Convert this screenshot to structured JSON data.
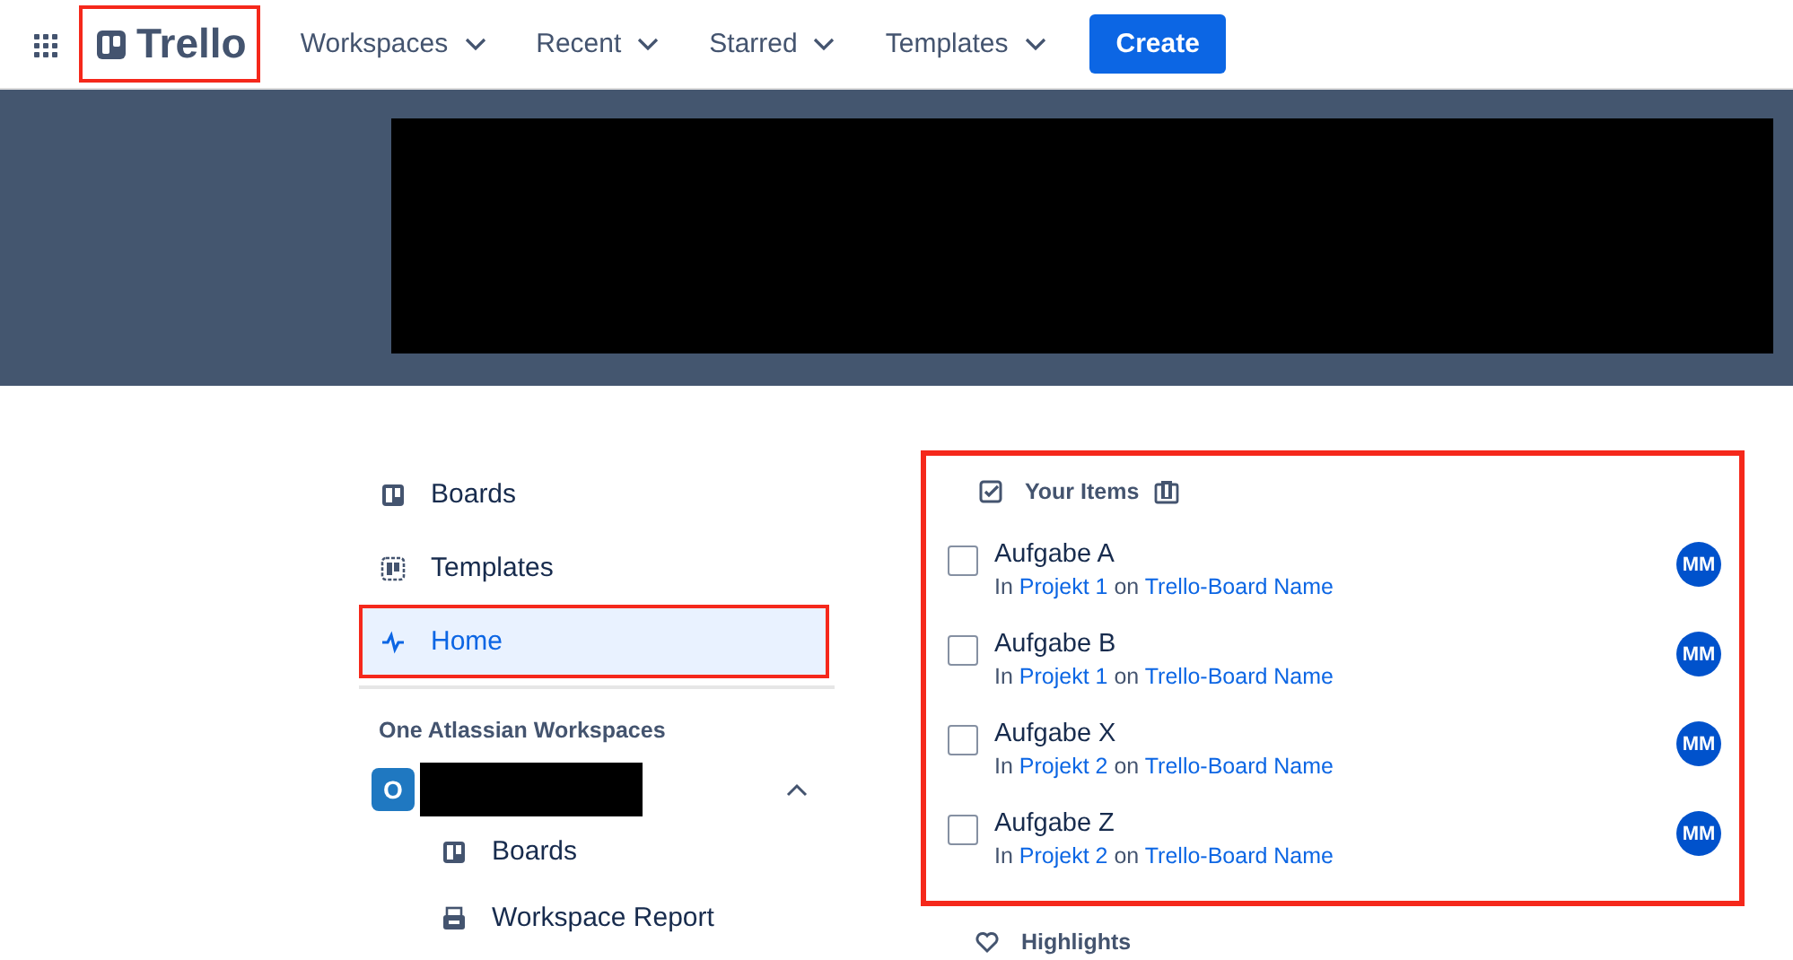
{
  "header": {
    "logo": {
      "text": "Trello",
      "highlighted": true
    },
    "menus": [
      {
        "label": "Workspaces"
      },
      {
        "label": "Recent"
      },
      {
        "label": "Starred"
      },
      {
        "label": "Templates"
      }
    ],
    "create_button": "Create"
  },
  "sidebar": {
    "items": [
      {
        "label": "Boards",
        "kind": "boards",
        "selected": false,
        "highlighted": false
      },
      {
        "label": "Templates",
        "kind": "templates",
        "selected": false,
        "highlighted": false
      },
      {
        "label": "Home",
        "kind": "home",
        "selected": true,
        "highlighted": true
      }
    ],
    "section_title": "One Atlassian Workspaces",
    "workspace": {
      "initial": "O",
      "expanded": true,
      "items": [
        {
          "label": "Boards",
          "kind": "boards"
        },
        {
          "label": "Workspace Report",
          "kind": "report"
        }
      ]
    }
  },
  "your_items": {
    "title": "Your Items",
    "highlighted": true,
    "items": [
      {
        "title": "Aufgabe A",
        "checked": false,
        "prefix": "In",
        "list": "Projekt 1",
        "joiner": "on",
        "board": "Trello-Board Name",
        "avatar": "MM"
      },
      {
        "title": "Aufgabe B",
        "checked": false,
        "prefix": "In",
        "list": "Projekt 1",
        "joiner": "on",
        "board": "Trello-Board Name",
        "avatar": "MM"
      },
      {
        "title": "Aufgabe X",
        "checked": false,
        "prefix": "In",
        "list": "Projekt 2",
        "joiner": "on",
        "board": "Trello-Board Name",
        "avatar": "MM"
      },
      {
        "title": "Aufgabe Z",
        "checked": false,
        "prefix": "In",
        "list": "Projekt 2",
        "joiner": "on",
        "board": "Trello-Board Name",
        "avatar": "MM"
      }
    ]
  },
  "highlights": {
    "title": "Highlights"
  }
}
